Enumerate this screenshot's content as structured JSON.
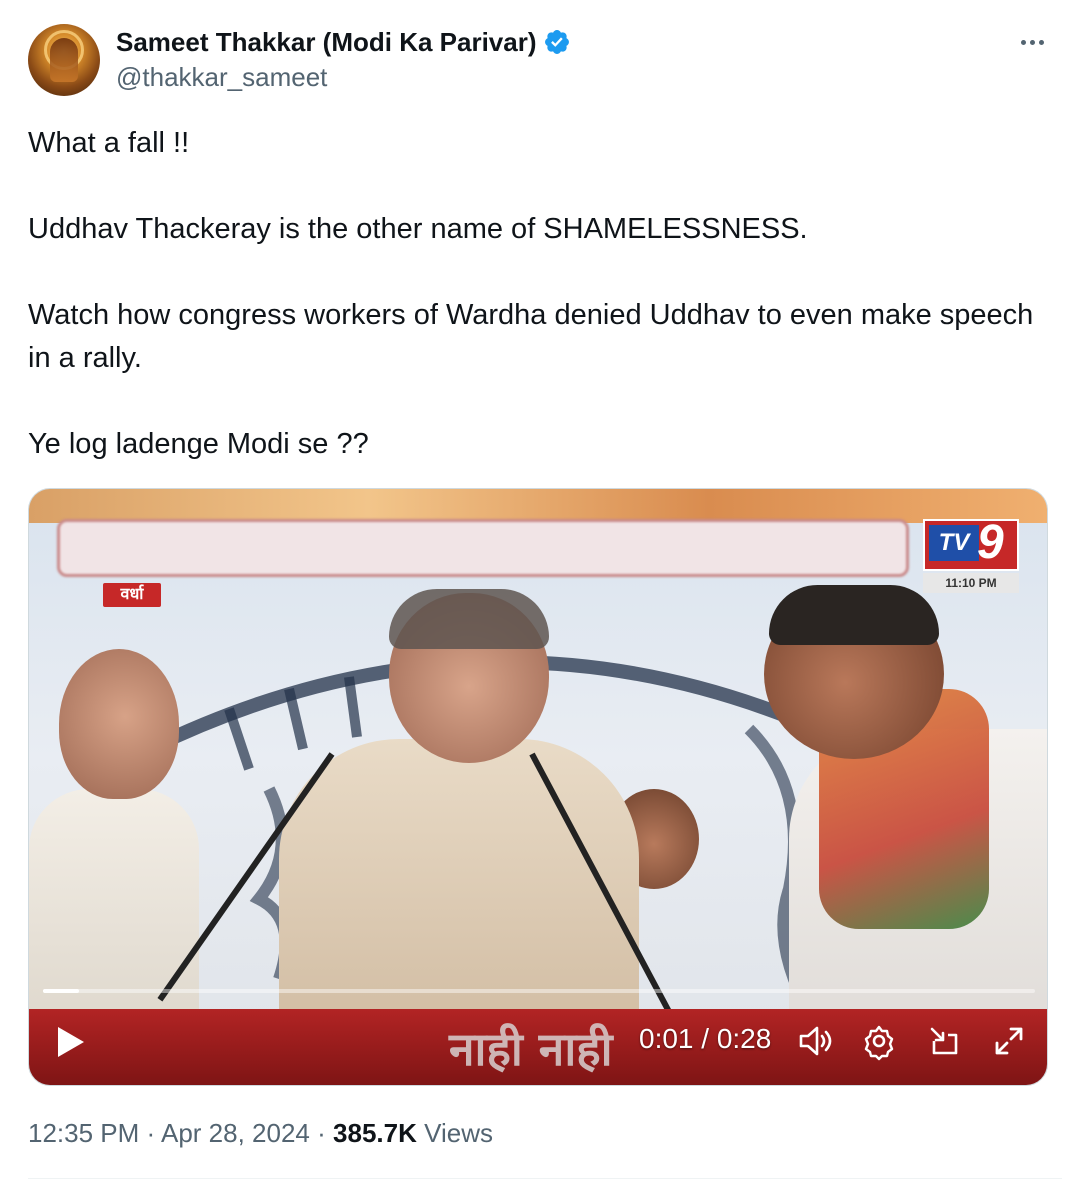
{
  "author": {
    "display_name": "Sameet Thakkar (Modi Ka Parivar)",
    "handle": "@thakkar_sameet",
    "verified": true,
    "verified_color": "#1d9bf0"
  },
  "tweet": {
    "paragraphs": [
      "What a fall !!",
      "Uddhav Thackeray is the other name of SHAMELESSNESS.",
      "Watch how congress workers of Wardha denied Uddhav to even make speech in a rally.",
      "Ye log ladenge Modi se ??"
    ]
  },
  "video": {
    "place_tag": "वर्धा",
    "channel_logo_tv": "TV",
    "channel_logo_number": "9",
    "channel_time": "11:10 PM",
    "caption": "नाही नाही",
    "current_time": "0:01",
    "duration": "0:28",
    "time_display": "0:01 / 0:28",
    "progress_fraction": 0.036,
    "icons": [
      "play-icon",
      "volume-icon",
      "settings-icon",
      "picture-in-picture-icon",
      "fullscreen-icon"
    ]
  },
  "meta": {
    "time": "12:35 PM",
    "date": "Apr 28, 2024",
    "views_count": "385.7K",
    "views_label": "Views",
    "separator": "·"
  }
}
